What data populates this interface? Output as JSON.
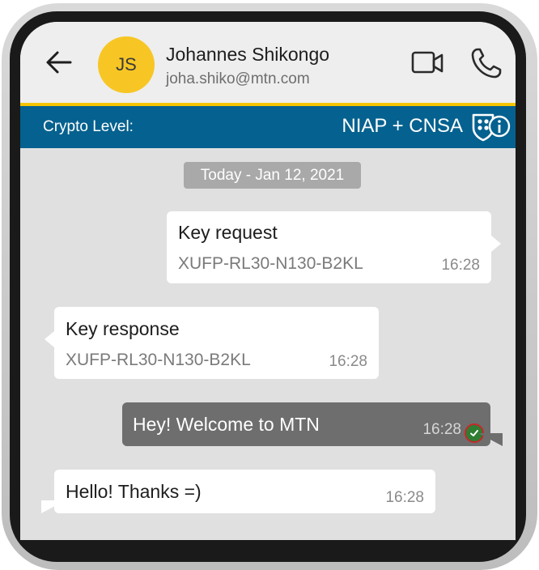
{
  "header": {
    "contact_initials": "JS",
    "contact_name": "Johannes Shikongo",
    "contact_email": "joha.shiko@mtn.com",
    "icons": [
      "back-arrow-icon",
      "video-call-icon",
      "phone-call-icon"
    ]
  },
  "crypto": {
    "label": "Crypto Level:",
    "value": "NIAP + CNSA",
    "icon": "shield-info-icon"
  },
  "chat": {
    "date": "Today - Jan 12, 2021",
    "messages": [
      {
        "direction": "outgoing",
        "text": "Key request",
        "subtext": "XUFP-RL30-N130-B2KL",
        "time": "16:28"
      },
      {
        "direction": "incoming",
        "text": "Key response",
        "subtext": "XUFP-RL30-N130-B2KL",
        "time": "16:28"
      },
      {
        "direction": "outgoing",
        "text": "Hey! Welcome to MTN",
        "time": "16:28",
        "status_icon": "read-check-icon"
      },
      {
        "direction": "incoming",
        "text": "Hello! Thanks =)",
        "time": "16:28"
      }
    ]
  },
  "colors": {
    "accent_yellow": "#f5c500",
    "crypto_bar": "#05618f",
    "outgoing_dark_bubble": "#6e6e6e",
    "chat_background": "#e0e0e0"
  }
}
